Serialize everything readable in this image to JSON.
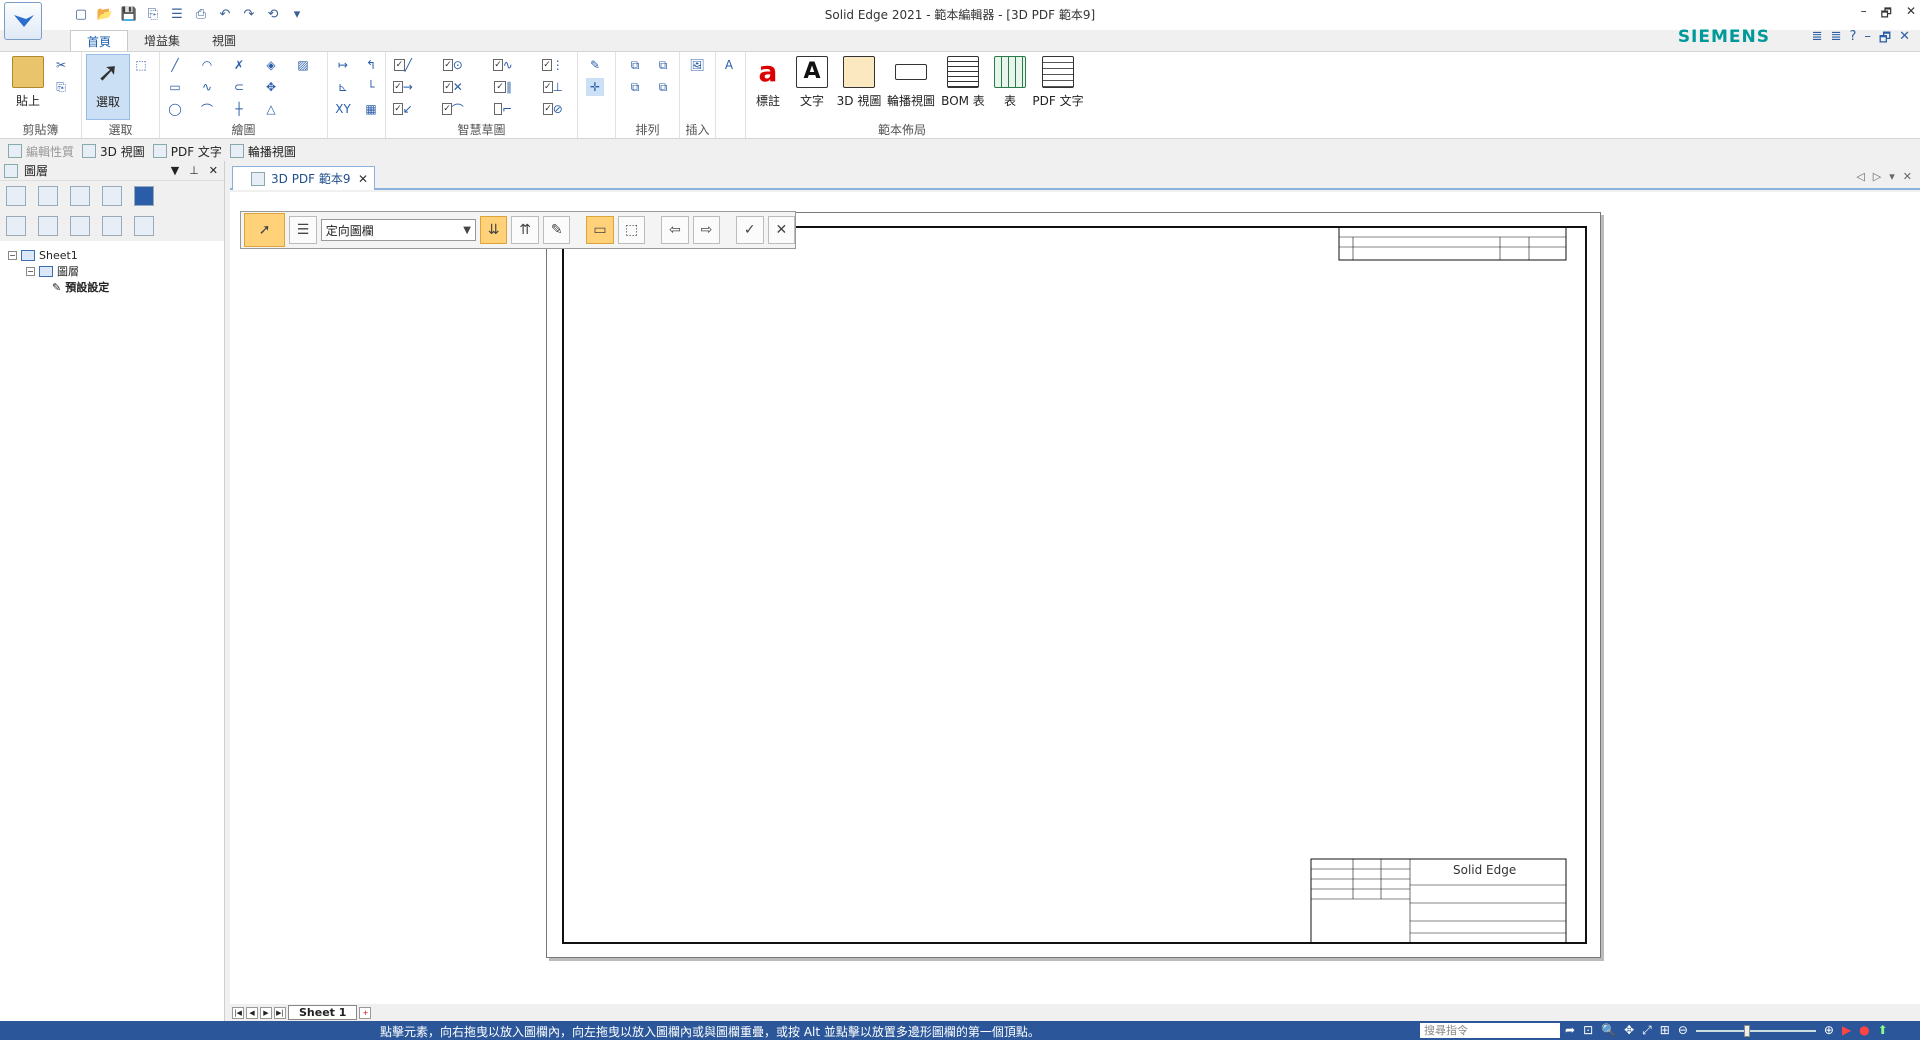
{
  "window": {
    "title": "Solid Edge 2021 - 範本編輯器 - [3D PDF 範本9]",
    "controls": [
      "–",
      "🗗",
      "✕"
    ],
    "brand": "SIEMENS"
  },
  "ribbon_tabs": [
    "首頁",
    "增益集",
    "視圖"
  ],
  "ribbon": {
    "clipboard": {
      "paste_label": "貼上",
      "group_label": "剪貼簿"
    },
    "select": {
      "select_label": "選取",
      "group_label": "選取"
    },
    "draw": {
      "group_label": "繪圖"
    },
    "smart": {
      "group_label": "智慧草圖"
    },
    "arrange": {
      "group_label": "排列"
    },
    "insert": {
      "group_label": "插入"
    },
    "layout": {
      "group_label": "範本佈局",
      "buttons": [
        "標註",
        "文字",
        "3D 視圖",
        "輪播視圖",
        "BOM 表",
        "表",
        "PDF 文字"
      ],
      "icon_names": [
        "callout-icon",
        "text-icon",
        "3d-view-icon",
        "carousel-view-icon",
        "bom-table-icon",
        "table-icon",
        "pdf-text-icon"
      ]
    }
  },
  "subbar": {
    "items": [
      "編輯性質",
      "3D 視圖",
      "PDF 文字",
      "輪播視圖"
    ]
  },
  "left_panel": {
    "title": "圖層",
    "tree": {
      "root": "Sheet1",
      "child": "圖層",
      "leaf": "預設設定"
    }
  },
  "document": {
    "tab_label": "3D PDF 範本9",
    "sheet_tab": "Sheet 1"
  },
  "float_toolbar": {
    "select_value": "定向圖欄"
  },
  "status": {
    "message": "點擊元素，向右拖曳以放入圖欄內，向左拖曳以放入圖欄內或與圖欄重疊，或按 Alt 並點擊以放置多邊形圖欄的第一個頂點。",
    "search_placeholder": "搜尋指令"
  },
  "colors": {
    "brand": "#009999",
    "statusbar": "#2b579a",
    "selected_tool": "#ffd27a"
  }
}
